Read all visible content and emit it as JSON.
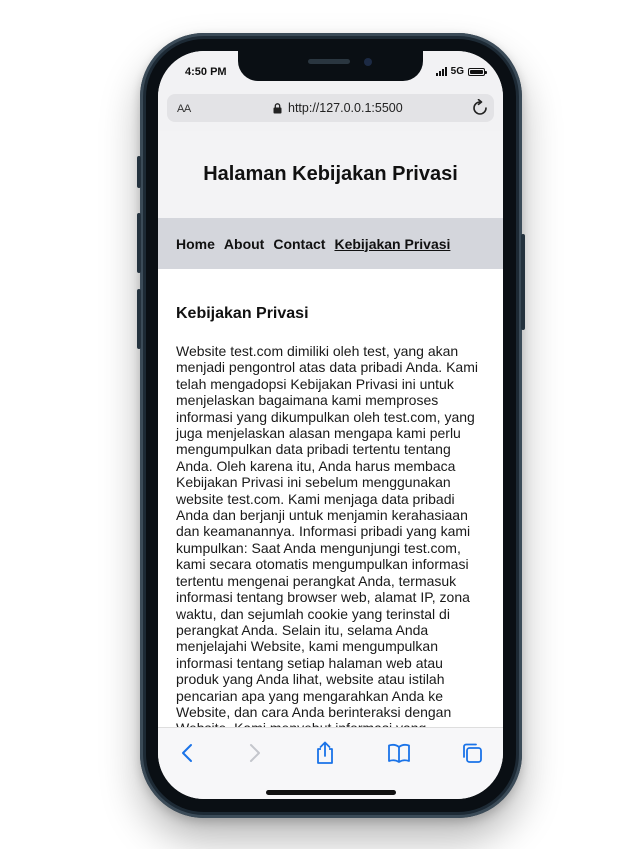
{
  "status_bar": {
    "time": "4:50 PM",
    "network": "5G",
    "battery_level": 1.0
  },
  "browser": {
    "text_size_label": "AA",
    "url": "http://127.0.0.1:5500"
  },
  "page": {
    "title": "Halaman Kebijakan Privasi",
    "nav": [
      {
        "label": "Home",
        "active": false
      },
      {
        "label": "About",
        "active": false
      },
      {
        "label": "Contact",
        "active": false
      },
      {
        "label": "Kebijakan Privasi",
        "active": true
      }
    ],
    "section_heading": "Kebijakan Privasi",
    "body": "Website test.com dimiliki oleh test, yang akan menjadi pengontrol atas data pribadi Anda. Kami telah mengadopsi Kebijakan Privasi ini untuk menjelaskan bagaimana kami memproses informasi yang dikumpulkan oleh test.com, yang juga menjelaskan alasan mengapa kami perlu mengumpulkan data pribadi tertentu tentang Anda. Oleh karena itu, Anda harus membaca Kebijakan Privasi ini sebelum menggunakan website test.com. Kami menjaga data pribadi Anda dan berjanji untuk menjamin kerahasiaan dan keamanannya. Informasi pribadi yang kami kumpulkan: Saat Anda mengunjungi test.com, kami secara otomatis mengumpulkan informasi tertentu mengenai perangkat Anda, termasuk informasi tentang browser web, alamat IP, zona waktu, dan sejumlah cookie yang terinstal di perangkat Anda. Selain itu, selama Anda menjelajahi Website, kami mengumpulkan informasi tentang setiap halaman web atau produk yang Anda lihat, website atau istilah pencarian apa yang mengarahkan Anda ke Website, dan cara Anda berinteraksi dengan Website. Kami menyebut informasi yang"
  },
  "toolbar": {
    "icons": [
      "back-icon",
      "forward-icon",
      "share-icon",
      "bookmarks-icon",
      "tabs-icon"
    ]
  },
  "colors": {
    "accent": "#1a73e8",
    "phone_frame": "#1d2a35",
    "nav_background": "#d4d6dc",
    "header_background": "#f3f3f5"
  }
}
